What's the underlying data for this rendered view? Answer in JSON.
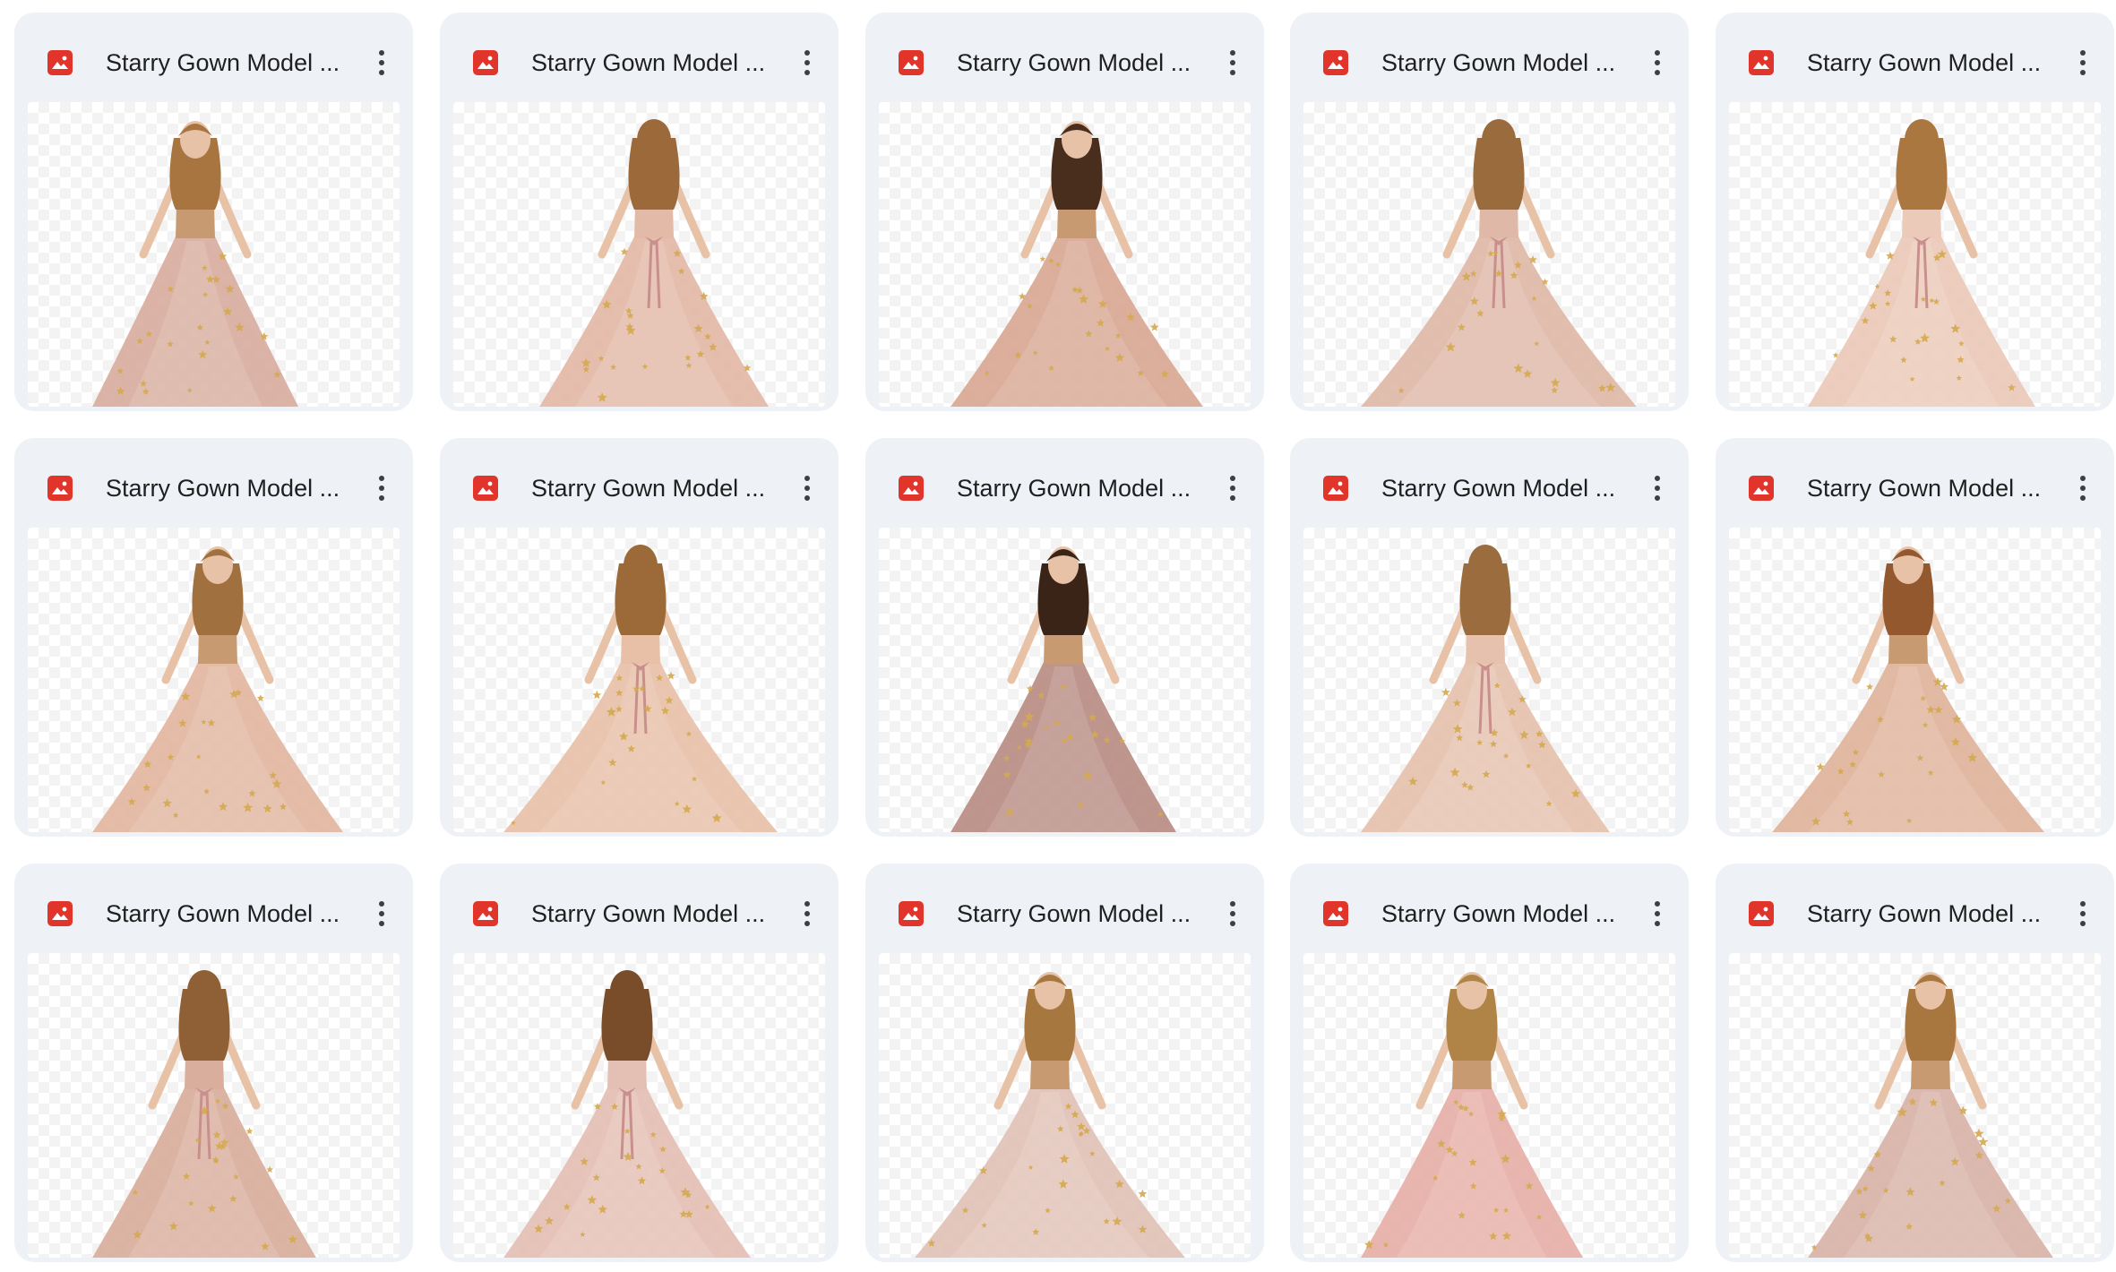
{
  "files": [
    {
      "name": "Starry Gown Model ...",
      "icon": "image-file-icon",
      "pose": "front",
      "dress": "#d8ae9f",
      "hair": "#a8743f"
    },
    {
      "name": "Starry Gown Model ...",
      "icon": "image-file-icon",
      "pose": "back",
      "dress": "#e3b9a7",
      "hair": "#9c6a3a"
    },
    {
      "name": "Starry Gown Model ...",
      "icon": "image-file-icon",
      "pose": "front",
      "dress": "#d9a894",
      "hair": "#4a2e1d"
    },
    {
      "name": "Starry Gown Model ...",
      "icon": "image-file-icon",
      "pose": "back",
      "dress": "#e0b8a8",
      "hair": "#9a6b3c"
    },
    {
      "name": "Starry Gown Model ...",
      "icon": "image-file-icon",
      "pose": "back",
      "dress": "#ebcab9",
      "hair": "#a9773f"
    },
    {
      "name": "Starry Gown Model ...",
      "icon": "image-file-icon",
      "pose": "front",
      "dress": "#e2b6a1",
      "hair": "#a0703f"
    },
    {
      "name": "Starry Gown Model ...",
      "icon": "image-file-icon",
      "pose": "back",
      "dress": "#e8c0a8",
      "hair": "#9b6a38"
    },
    {
      "name": "Starry Gown Model ...",
      "icon": "image-file-icon",
      "pose": "front",
      "dress": "#b98d84",
      "hair": "#3a2418"
    },
    {
      "name": "Starry Gown Model ...",
      "icon": "image-file-icon",
      "pose": "back",
      "dress": "#e6c1ae",
      "hair": "#9a6c3e"
    },
    {
      "name": "Starry Gown Model ...",
      "icon": "image-file-icon",
      "pose": "front",
      "dress": "#e0b39b",
      "hair": "#93582e"
    },
    {
      "name": "Starry Gown Model ...",
      "icon": "image-file-icon",
      "pose": "back",
      "dress": "#d9ae9c",
      "hair": "#8f6036"
    },
    {
      "name": "Starry Gown Model ...",
      "icon": "image-file-icon",
      "pose": "back",
      "dress": "#e4bfb4",
      "hair": "#7a4d2a"
    },
    {
      "name": "Starry Gown Model ...",
      "icon": "image-file-icon",
      "pose": "front",
      "dress": "#e2c2b6",
      "hair": "#a6783f"
    },
    {
      "name": "Starry Gown Model ...",
      "icon": "image-file-icon",
      "pose": "front",
      "dress": "#e7b0a8",
      "hair": "#b08447"
    },
    {
      "name": "Starry Gown Model ...",
      "icon": "image-file-icon",
      "pose": "front",
      "dress": "#d8b3a8",
      "hair": "#a8773f"
    }
  ],
  "colors": {
    "card_bg": "#eef1f6",
    "icon_red": "#e1342b",
    "title_text": "#1f1f1f",
    "star_gold": "#d4a94f"
  }
}
